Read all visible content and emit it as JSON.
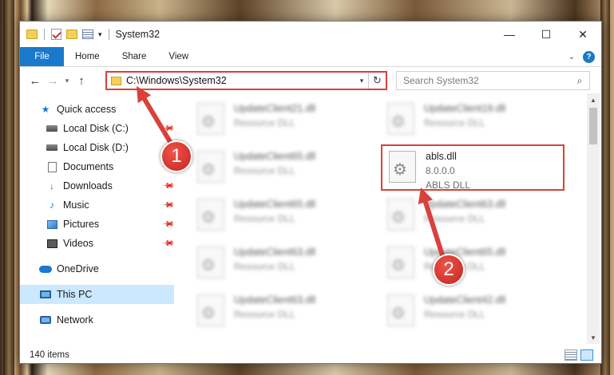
{
  "window": {
    "title": "System32",
    "controls": {
      "minimize": "—",
      "maximize": "☐",
      "close": "✕"
    }
  },
  "ribbon": {
    "tabs": [
      "File",
      "Home",
      "Share",
      "View"
    ]
  },
  "address_bar": {
    "path": "C:\\Windows\\System32"
  },
  "search": {
    "placeholder": "Search System32"
  },
  "nav_pane": {
    "items": [
      {
        "label": "Quick access",
        "icon": "star-icon"
      },
      {
        "label": "Local Disk (C:)",
        "icon": "disk-icon",
        "pinned": true
      },
      {
        "label": "Local Disk (D:)",
        "icon": "disk-icon",
        "pinned": true
      },
      {
        "label": "Documents",
        "icon": "documents-icon",
        "pinned": true
      },
      {
        "label": "Downloads",
        "icon": "downloads-icon",
        "pinned": true
      },
      {
        "label": "Music",
        "icon": "music-icon",
        "pinned": true
      },
      {
        "label": "Pictures",
        "icon": "pictures-icon",
        "pinned": true
      },
      {
        "label": "Videos",
        "icon": "videos-icon",
        "pinned": true
      },
      {
        "label": "OneDrive",
        "icon": "onedrive-icon"
      },
      {
        "label": "This PC",
        "icon": "pc-icon",
        "selected": true
      },
      {
        "label": "Network",
        "icon": "network-icon"
      }
    ]
  },
  "files": [
    {
      "name": "UpdateClient21.dll",
      "type": "Resource DLL"
    },
    {
      "name": "UpdateClient19.dll",
      "type": "Resource DLL"
    },
    {
      "name": "UpdateClient65.dll",
      "type": "Resource DLL"
    },
    {
      "name": "abls.dll",
      "version": "8.0.0.0",
      "type": "ABLS DLL"
    },
    {
      "name": "UpdateClient65.dll",
      "type": "Resource DLL"
    },
    {
      "name": "UpdateClient63.dll",
      "type": "Resource DLL"
    },
    {
      "name": "UpdateClient63.dll",
      "type": "Resource DLL"
    },
    {
      "name": "UpdateClient65.dll",
      "type": "Resource DLL"
    },
    {
      "name": "UpdateClient63.dll",
      "type": "Resource DLL"
    },
    {
      "name": "UpdateClient42.dll",
      "type": "Resource DLL"
    }
  ],
  "status": {
    "item_count": "140 items"
  },
  "annotations": {
    "badge1": "1",
    "badge2": "2",
    "color": "#d9413a"
  }
}
